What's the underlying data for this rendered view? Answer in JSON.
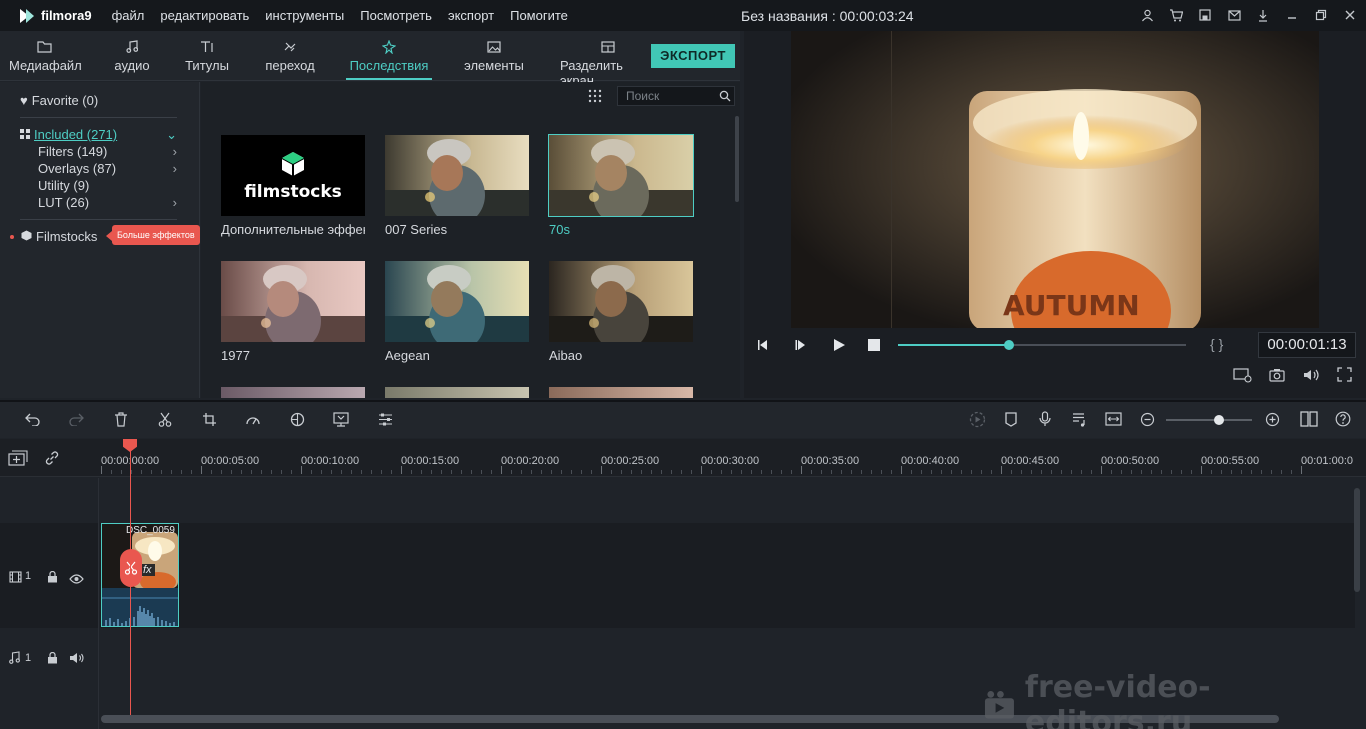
{
  "app": {
    "name": "filmora9",
    "window_title": "Без названия : 00:00:03:24"
  },
  "menu": [
    "файл",
    "редактировать",
    "инструменты",
    "Посмотреть",
    "экспорт",
    "Помогите"
  ],
  "title_icons": [
    "account-icon",
    "cart-icon",
    "save-icon",
    "mail-icon",
    "download-icon",
    "minimize-icon",
    "restore-icon",
    "close-icon"
  ],
  "tabs": [
    {
      "label": "Медиафайл",
      "icon": "folder-icon"
    },
    {
      "label": "аудио",
      "icon": "music-icon"
    },
    {
      "label": "Титулы",
      "icon": "text-icon"
    },
    {
      "label": "переход",
      "icon": "transition-icon"
    },
    {
      "label": "Последствия",
      "icon": "effects-icon",
      "active": true
    },
    {
      "label": "элементы",
      "icon": "image-icon"
    },
    {
      "label": "Разделить экран",
      "icon": "split-screen-icon"
    }
  ],
  "export_label": "ЭКСПОРТ",
  "sidebar": {
    "favorite": "Favorite (0)",
    "included": "Included (271)",
    "items": [
      "Filters (149)",
      "Overlays (87)",
      "Utility (9)",
      "LUT (26)"
    ],
    "filmstocks": "Filmstocks",
    "tooltip": "Больше эффектов"
  },
  "search": {
    "placeholder": "Поиск"
  },
  "effects": [
    {
      "label": "Дополнительные эффек",
      "logo_text": "filmstocks"
    },
    {
      "label": "007 Series"
    },
    {
      "label": "70s",
      "selected": true
    },
    {
      "label": "1977"
    },
    {
      "label": "Aegean"
    },
    {
      "label": "Aibao"
    }
  ],
  "player": {
    "time": "00:00:01:13",
    "progress": 0.385,
    "braces": "{ }"
  },
  "ruler": [
    "00:00:00:00",
    "00:00:05:00",
    "00:00:10:00",
    "00:00:15:00",
    "00:00:20:00",
    "00:00:25:00",
    "00:00:30:00",
    "00:00:35:00",
    "00:00:40:00",
    "00:00:45:00",
    "00:00:50:00",
    "00:00:55:00",
    "00:01:00:0"
  ],
  "tracks": {
    "video_label": "1",
    "audio_label": "1"
  },
  "clip": {
    "name": "DSC_0059",
    "fx": "fx"
  },
  "watermark": "free-video-editors.ru",
  "colors": {
    "accent": "#4ecdc4",
    "playhead": "#e9574f",
    "background": "#1f2329"
  }
}
